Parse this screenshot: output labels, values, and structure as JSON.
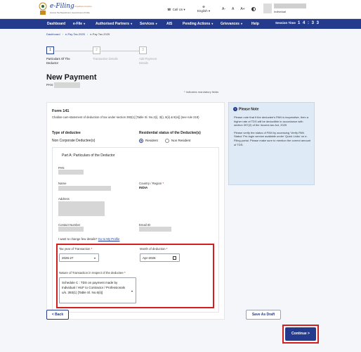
{
  "header": {
    "brand_prefix": "e-Filing",
    "brand_tag": "Anywhere Anytime",
    "brand_sub": "Income Tax Department, Government of India",
    "call_us": "Call Us",
    "language": "English",
    "font_decrease": "A-",
    "font_reset": "A",
    "font_increase": "A+",
    "user_type": "Individual"
  },
  "nav": {
    "items": [
      "Dashboard",
      "e-File",
      "Authorised Partners",
      "Services",
      "AIS",
      "Pending Actions",
      "Grievances",
      "Help"
    ],
    "session_label": "Session Time",
    "session_time": "1 4 : 3 3"
  },
  "breadcrumb": [
    "Dashboard",
    "e-Pay Tax-2025",
    "e-Pay Tax-2025"
  ],
  "stepper": {
    "steps": [
      {
        "num": "1",
        "label": "Particulars Of The Deductor"
      },
      {
        "num": "2",
        "label": "Transaction Details"
      },
      {
        "num": "3",
        "label": "Add Payment Details"
      }
    ]
  },
  "page": {
    "title": "New Payment",
    "pan_label": "PAN:",
    "mandatory_note": "* Indicates mandatory fields"
  },
  "form": {
    "form_no": "Form 141",
    "description": "Challan-cum-statement of deduction of tax under section 393(1) [Table Sl. No.2(i), 3(i), 6(ii) & 8(vi)] (see rule 218)",
    "type_label": "Type of deductee",
    "type_value": "Non Corporate Deductee(s)",
    "residential_label": "Residential status of the Deductee(s)",
    "radio_resident": "Resident",
    "radio_nonresident": "Non Resident",
    "section_title": "Part A: Particulars of the Deductor",
    "pan_field": "PAN",
    "name_field": "Name",
    "country_field": "Country / Region",
    "country_value": "INDIA",
    "address_field": "Address",
    "contact_field": "Contact Number",
    "email_field": "Email ID",
    "change_text": "I want to change few details?",
    "change_link": "Go to My Profile",
    "tax_year_label": "Tax year of Transaction",
    "tax_year_value": "2026-27",
    "month_label": "Month of deduction",
    "month_value": "Apr-2026",
    "nature_label": "Nature of Transaction in respect of the deductee",
    "nature_value": "Schedule C : TDS on payment made by Individual / HUF to Contractor / Professionals u/s. 393(1) [Table Sl. No.6(ii)]"
  },
  "note": {
    "title": "Please Note",
    "points": [
      "Please note that if the deductee's PAN is inoperative, then a higher rate of TDS will be deductible in accordance with section 397(2) of the Income-tax Act, 2025",
      "Please verify the status of PAN by accessing 'Verify PAN Status' Pre-login service available under 'Quick Links' on e-Filing portal. Please make sure to mention the correct amount of TDS."
    ]
  },
  "buttons": {
    "back": "< Back",
    "save_draft": "Save As Draft",
    "continue": "Continue >"
  },
  "colors": {
    "primary": "#243a8c",
    "highlight": "#d21f1f",
    "note_bg": "#deebf7"
  }
}
